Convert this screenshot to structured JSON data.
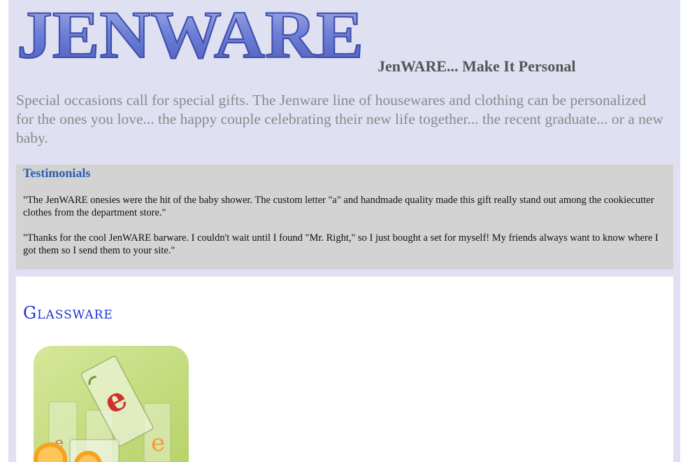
{
  "header": {
    "logo_text": "JENWARE",
    "tagline": "JenWARE... Make It Personal"
  },
  "intro": "Special occasions call for special gifts. The Jenware line of housewares and clothing can be personalized for the ones you love... the happy couple celebrating their new life together... the recent graduate... or a new baby.",
  "testimonials": {
    "heading": "Testimonials",
    "quotes": [
      "\"The JenWARE onesies were the hit of the baby shower. The custom letter \"a\" and handmade quality made this gift really stand out among the cookiecutter clothes from the department store.\"",
      "\"Thanks for the cool JenWARE barware. I couldn't wait until I found \"Mr. Right,\" so I just bought a set for myself! My friends always want to know where I got them so I send them to your site.\""
    ]
  },
  "products": {
    "heading": "Glassware",
    "image_alt": "glassware-photo"
  },
  "colors": {
    "page_bg": "#dfe0f1",
    "logo_fill": "#6f7fd4",
    "testimonial_bg": "#d3d3d3",
    "testimonial_heading": "#2a5db0",
    "products_heading": "#1f2fd6"
  }
}
